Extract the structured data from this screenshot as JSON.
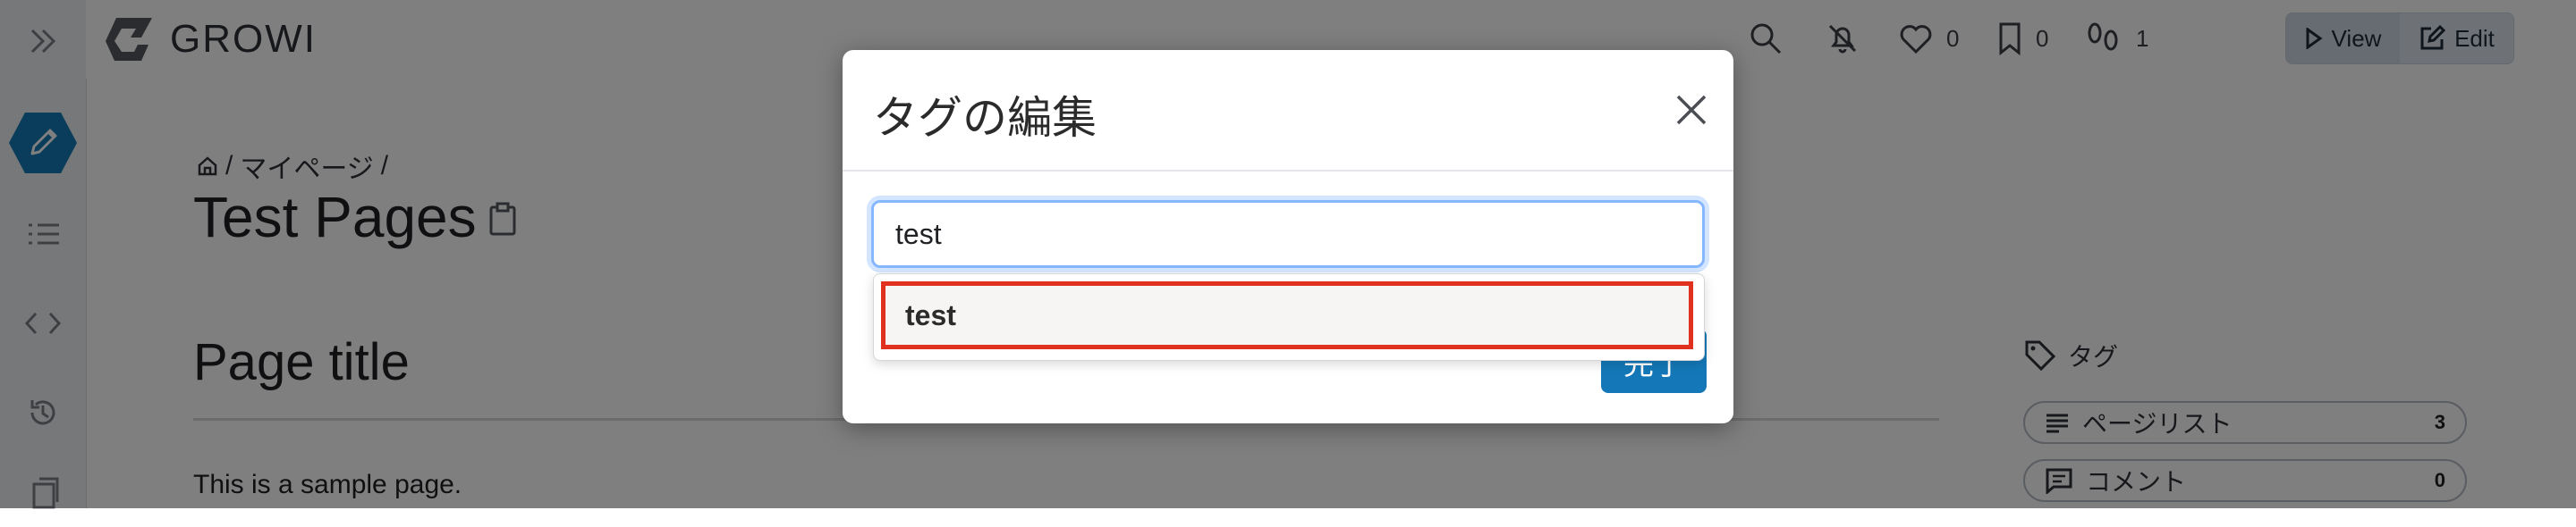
{
  "topnav": {
    "brand": "GROWI",
    "like_count": "0",
    "bookmark_count": "0",
    "seen_count": "1",
    "view_label": "View",
    "edit_label": "Edit"
  },
  "page": {
    "breadcrumb_item": "マイページ",
    "breadcrumb_sep1": "/",
    "breadcrumb_sep2": "/",
    "title": "Test Pages",
    "section_heading": "Page title",
    "body_text": "This is a sample page."
  },
  "side_panel": {
    "tags_label": "タグ",
    "items": [
      {
        "label": "ページリスト",
        "count": "3",
        "icon": "list-icon"
      },
      {
        "label": "コメント",
        "count": "0",
        "icon": "comment-icon"
      }
    ]
  },
  "modal": {
    "title": "タグの編集",
    "input_value": "test",
    "suggestion": "test",
    "done_label": "完了"
  },
  "colors": {
    "accent": "#1478b8",
    "highlight_border": "#e0301e",
    "overlay": "rgba(0,0,0,0.5)"
  }
}
